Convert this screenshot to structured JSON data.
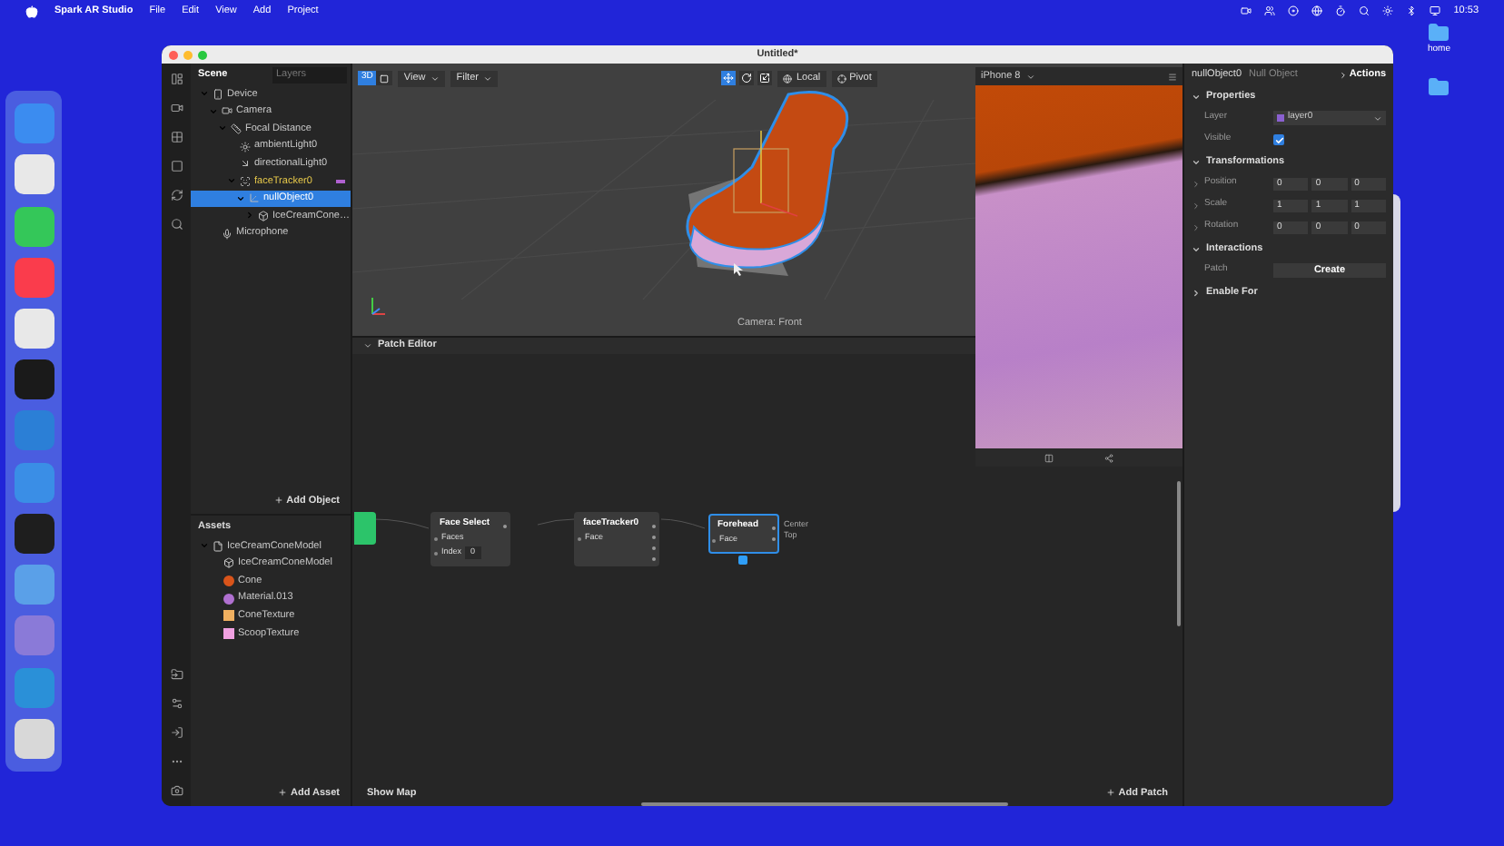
{
  "menu_bar": {
    "app": "Spark AR Studio",
    "menus": [
      "File",
      "Edit",
      "View",
      "Add",
      "Project"
    ],
    "clock": "10:53"
  },
  "dock_apps": [
    {
      "color": "#3b8cf0"
    },
    {
      "color": "#e8e8e8"
    },
    {
      "color": "#34c759"
    },
    {
      "color": "#fa3c4c"
    },
    {
      "color": "#e8e8e8"
    },
    {
      "color": "#1a1a1a"
    },
    {
      "color": "#2b7fd6"
    },
    {
      "color": "#3a8ee6"
    },
    {
      "color": "#1e1e1e"
    },
    {
      "color": "#5aa0e8"
    },
    {
      "color": "#8a7ad8"
    },
    {
      "color": "#2a90d8"
    },
    {
      "color": "#d8d8d8"
    }
  ],
  "desktop_icons": [
    {
      "label": "home"
    }
  ],
  "window": {
    "title": "Untitled*"
  },
  "scene_panel": {
    "tabs": [
      {
        "label": "Scene",
        "selected": true
      },
      {
        "label": "Layers",
        "selected": false
      }
    ],
    "tree": [
      {
        "label": "Device",
        "kind": "device",
        "expanded": true,
        "selected": false,
        "children": [
          {
            "label": "Camera",
            "kind": "camera",
            "expanded": true,
            "selected": false,
            "children": [
              {
                "label": "Focal Distance",
                "kind": "focal",
                "expanded": true,
                "selected": false,
                "children": [
                  {
                    "label": "ambientLight0",
                    "kind": "light",
                    "selected": false
                  },
                  {
                    "label": "directionalLight0",
                    "kind": "directional",
                    "selected": false
                  },
                  {
                    "label": "faceTracker0",
                    "kind": "tracker",
                    "expanded": true,
                    "selected": false,
                    "children": [
                      {
                        "label": "nullObject0",
                        "kind": "null",
                        "expanded": true,
                        "selected": true,
                        "children": [
                          {
                            "label": "IceCreamCone…",
                            "kind": "mesh",
                            "expanded": false,
                            "selected": false
                          }
                        ]
                      }
                    ]
                  }
                ]
              }
            ]
          },
          {
            "label": "Microphone",
            "kind": "microphone",
            "selected": false
          }
        ]
      }
    ],
    "add_button": "Add Object"
  },
  "assets_panel": {
    "title": "Assets",
    "tree": [
      {
        "label": "IceCreamConeModel",
        "kind": "folder",
        "expanded": true,
        "children": [
          {
            "label": "IceCreamConeModel",
            "kind": "mesh"
          },
          {
            "label": "Cone",
            "kind": "material",
            "color": "#d9541a"
          },
          {
            "label": "Material.013",
            "kind": "material",
            "color": "#b070d0"
          },
          {
            "label": "ConeTexture",
            "kind": "texture",
            "color": "#f0b060"
          },
          {
            "label": "ScoopTexture",
            "kind": "texture",
            "color": "#f0a0e0"
          }
        ]
      }
    ],
    "add_button": "Add Asset"
  },
  "viewport": {
    "view_modes": [
      {
        "kind": "perspective",
        "label": "3D",
        "selected": true
      },
      {
        "kind": "flat",
        "selected": false
      }
    ],
    "dropdowns": [
      "View",
      "Filter"
    ],
    "transform_tools": [
      {
        "kind": "move",
        "selected": true
      },
      {
        "kind": "rotate",
        "selected": false
      },
      {
        "kind": "scale",
        "selected": false
      }
    ],
    "space_toggles": [
      {
        "kind": "local",
        "label": "Local"
      },
      {
        "kind": "pivot",
        "label": "Pivot"
      }
    ],
    "camera_label": "Camera: Front"
  },
  "preview": {
    "device": "iPhone 8"
  },
  "patch_editor": {
    "title": "Patch Editor",
    "nodes": [
      {
        "title": "Face Select",
        "selected": false,
        "inputs": [
          {
            "label": "Faces"
          },
          {
            "label": "Index",
            "value": "0"
          }
        ],
        "outputs": [
          {
            "kind": "port"
          }
        ]
      },
      {
        "title": "faceTracker0",
        "selected": false,
        "inputs": [
          {
            "label": "Face"
          }
        ],
        "outputs": [
          {
            "kind": "port"
          },
          {
            "kind": "port"
          },
          {
            "kind": "port"
          },
          {
            "kind": "port"
          }
        ]
      },
      {
        "title": "Forehead",
        "selected": true,
        "inputs": [
          {
            "label": "Face"
          }
        ],
        "outputs": [
          {
            "kind": "labeled",
            "label": "Center"
          },
          {
            "kind": "labeled",
            "label": "Top"
          }
        ]
      }
    ],
    "show_map": "Show Map",
    "add_button": "Add Patch"
  },
  "inspector": {
    "object_name": "nullObject0",
    "object_type": "Null Object",
    "actions": "Actions",
    "sections": [
      {
        "title": "Properties",
        "expanded": true,
        "rows": [
          {
            "kind": "dropdown",
            "label": "Layer",
            "value": "layer0",
            "color": "#8a60d0"
          },
          {
            "kind": "checkbox",
            "label": "Visible",
            "checked": true
          }
        ]
      },
      {
        "title": "Transformations",
        "expanded": true,
        "rows": [
          {
            "kind": "vector",
            "label": "Position",
            "values": [
              "0",
              "0",
              "0"
            ]
          },
          {
            "kind": "vector",
            "label": "Scale",
            "values": [
              "1",
              "1",
              "1"
            ]
          },
          {
            "kind": "vector",
            "label": "Rotation",
            "values": [
              "0",
              "0",
              "0"
            ]
          }
        ]
      },
      {
        "title": "Interactions",
        "expanded": true,
        "rows": [
          {
            "kind": "button",
            "label": "Patch",
            "value": "Create"
          }
        ]
      },
      {
        "title": "Enable For",
        "expanded": false
      }
    ]
  }
}
